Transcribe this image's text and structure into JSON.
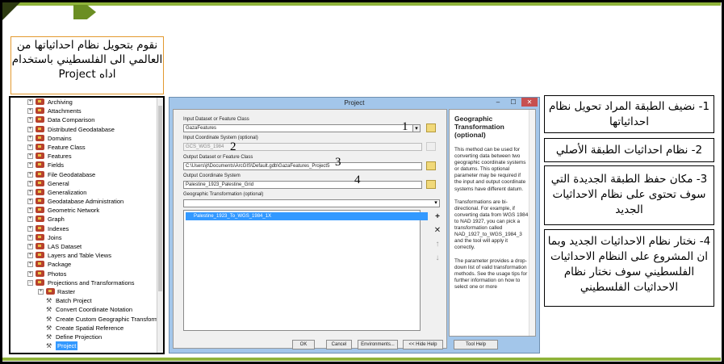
{
  "slide": {
    "title": "نقوم بتحويل نظام احداثياتها من العالمي الى الفلسطيني باستخدام اداه Project"
  },
  "tree": {
    "items": [
      {
        "label": "Archiving",
        "kind": "toolbox"
      },
      {
        "label": "Attachments",
        "kind": "toolbox"
      },
      {
        "label": "Data Comparison",
        "kind": "toolbox"
      },
      {
        "label": "Distributed Geodatabase",
        "kind": "toolbox"
      },
      {
        "label": "Domains",
        "kind": "toolbox"
      },
      {
        "label": "Feature Class",
        "kind": "toolbox"
      },
      {
        "label": "Features",
        "kind": "toolbox"
      },
      {
        "label": "Fields",
        "kind": "toolbox"
      },
      {
        "label": "File Geodatabase",
        "kind": "toolbox"
      },
      {
        "label": "General",
        "kind": "toolbox"
      },
      {
        "label": "Generalization",
        "kind": "toolbox"
      },
      {
        "label": "Geodatabase Administration",
        "kind": "toolbox"
      },
      {
        "label": "Geometric Network",
        "kind": "toolbox"
      },
      {
        "label": "Graph",
        "kind": "toolbox"
      },
      {
        "label": "Indexes",
        "kind": "toolbox"
      },
      {
        "label": "Joins",
        "kind": "toolbox"
      },
      {
        "label": "LAS Dataset",
        "kind": "toolbox"
      },
      {
        "label": "Layers and Table Views",
        "kind": "toolbox"
      },
      {
        "label": "Package",
        "kind": "toolbox"
      },
      {
        "label": "Photos",
        "kind": "toolbox"
      },
      {
        "label": "Projections and Transformations",
        "kind": "toolbox-open"
      },
      {
        "label": "Raster",
        "kind": "sub-toolbox"
      },
      {
        "label": "Batch Project",
        "kind": "tool"
      },
      {
        "label": "Convert Coordinate Notation",
        "kind": "tool"
      },
      {
        "label": "Create Custom Geographic Transform",
        "kind": "tool"
      },
      {
        "label": "Create Spatial Reference",
        "kind": "tool"
      },
      {
        "label": "Define Projection",
        "kind": "tool"
      },
      {
        "label": "Project",
        "kind": "tool-selected"
      }
    ]
  },
  "dialog": {
    "title": "Project",
    "minimize": "–",
    "maximize": "☐",
    "close": "✕",
    "input_dataset_label": "Input Dataset or Feature Class",
    "input_dataset_value": "GazaFeatures",
    "input_cs_label": "Input Coordinate System (optional)",
    "input_cs_value": "GCS_WGS_1984",
    "output_dataset_label": "Output Dataset or Feature Class",
    "output_dataset_value": "C:\\Users\\jt\\Documents\\ArcGIS\\Default.gdb\\GazaFeatures_Project5",
    "output_cs_label": "Output Coordinate System",
    "output_cs_value": "Palestine_1923_Palestine_Grid",
    "geo_transform_label": "Geographic Transformation (optional)",
    "geo_transform_selected": "Palestine_1923_To_WGS_1984_1X",
    "buttons": {
      "ok": "OK",
      "cancel": "Cancel",
      "environments": "Environments...",
      "hide_help": "<< Hide Help",
      "tool_help": "Tool Help"
    },
    "side_buttons": {
      "add": "+",
      "remove": "✕",
      "up": "↑",
      "down": "↓"
    },
    "markers": {
      "m1": "1",
      "m2": "2",
      "m3": "3",
      "m4": "4"
    }
  },
  "help": {
    "title": "Geographic Transformation (optional)",
    "text": "This method can be used for converting data between two geographic coordinate systems or datums. This optional parameter may be required if the input and output coordinate systems have different datum.\n\nTransformations are bi-directional. For example, if converting data from WGS 1984 to NAD 1927, you can pick a transformation called NAD_1927_to_WGS_1984_3 and the tool will apply it correctly.\n\nThe parameter provides a drop-down list of valid transformation methods. See the usage tips for further information on how to select one or more"
  },
  "steps": {
    "s1": "1- نضيف الطبقة المراد تحويل نظام احداثياتها",
    "s2": "2- نظام احداثيات الطبقة الأصلي",
    "s3": "3- مكان حفظ الطبقة الجديدة التي سوف تحتوى على نظام الاحداثيات الجديد",
    "s4": "4- نختار نظام الاحداثيات الجديد وبما ان المشروع على النظام الاحداثيات الفلسطيني سوف نختار نظام الاحداثيات الفلسطيني"
  },
  "colors": {
    "accent_green": "#8fb33a",
    "title_border": "#e39a2f",
    "dialog_frame": "#a3c6ea",
    "selection": "#3399ff",
    "toolbox_icon": "#b7412d"
  }
}
